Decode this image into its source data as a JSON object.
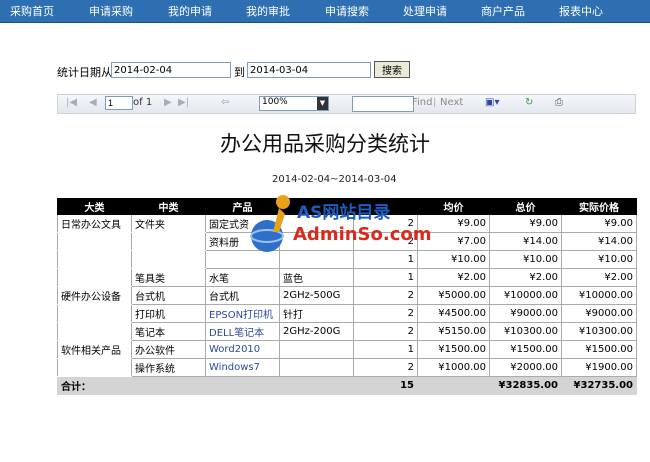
{
  "nav": [
    "采购首页",
    "申请采购",
    "我的申请",
    "我的审批",
    "申请搜索",
    "处理申请",
    "商户产品",
    "报表中心"
  ],
  "filter": {
    "label": "统计日期从",
    "start": "2014-02-04",
    "to_label": "到",
    "end": "2014-03-04",
    "search_label": "搜索"
  },
  "toolbar": {
    "page": "1",
    "of": "of 1",
    "zoom": "100%",
    "find": "Find",
    "next": "Next",
    "sep": "|"
  },
  "report": {
    "title": "办公用品采购分类统计",
    "range": "2014-02-04~2014-03-04",
    "headers": [
      "大类",
      "中类",
      "产品",
      "",
      "",
      "均价",
      "总价",
      "实际价格"
    ],
    "rows": [
      [
        "日常办公文具",
        "文件夹",
        "固定式资",
        "",
        "2",
        "¥9.00",
        "¥9.00",
        "¥9.00"
      ],
      [
        "",
        "",
        "资料册",
        "",
        "2",
        "¥7.00",
        "¥14.00",
        "¥14.00"
      ],
      [
        "",
        "",
        "",
        "",
        "1",
        "¥10.00",
        "¥10.00",
        "¥10.00"
      ],
      [
        "",
        "笔具类",
        "水笔",
        "蓝色",
        "1",
        "¥2.00",
        "¥2.00",
        "¥2.00"
      ],
      [
        "硬件办公设备",
        "台式机",
        "台式机",
        "2GHz-500G",
        "2",
        "¥5000.00",
        "¥10000.00",
        "¥10000.00"
      ],
      [
        "",
        "打印机",
        "EPSON打印机",
        "针打",
        "2",
        "¥4500.00",
        "¥9000.00",
        "¥9000.00"
      ],
      [
        "",
        "笔记本",
        "DELL笔记本",
        "2GHz-200G",
        "2",
        "¥5150.00",
        "¥10300.00",
        "¥10300.00"
      ],
      [
        "软件相关产品",
        "办公软件",
        "Word2010",
        "",
        "1",
        "¥1500.00",
        "¥1500.00",
        "¥1500.00"
      ],
      [
        "",
        "操作系统",
        "Windows7",
        "",
        "2",
        "¥1000.00",
        "¥2000.00",
        "¥1900.00"
      ]
    ],
    "total": {
      "label": "合计：",
      "qty": "15",
      "sum": "¥32835.00",
      "actual": "¥32735.00"
    }
  },
  "watermark": {
    "line1": "AS网站目录",
    "line2": "AdminSo.com"
  }
}
